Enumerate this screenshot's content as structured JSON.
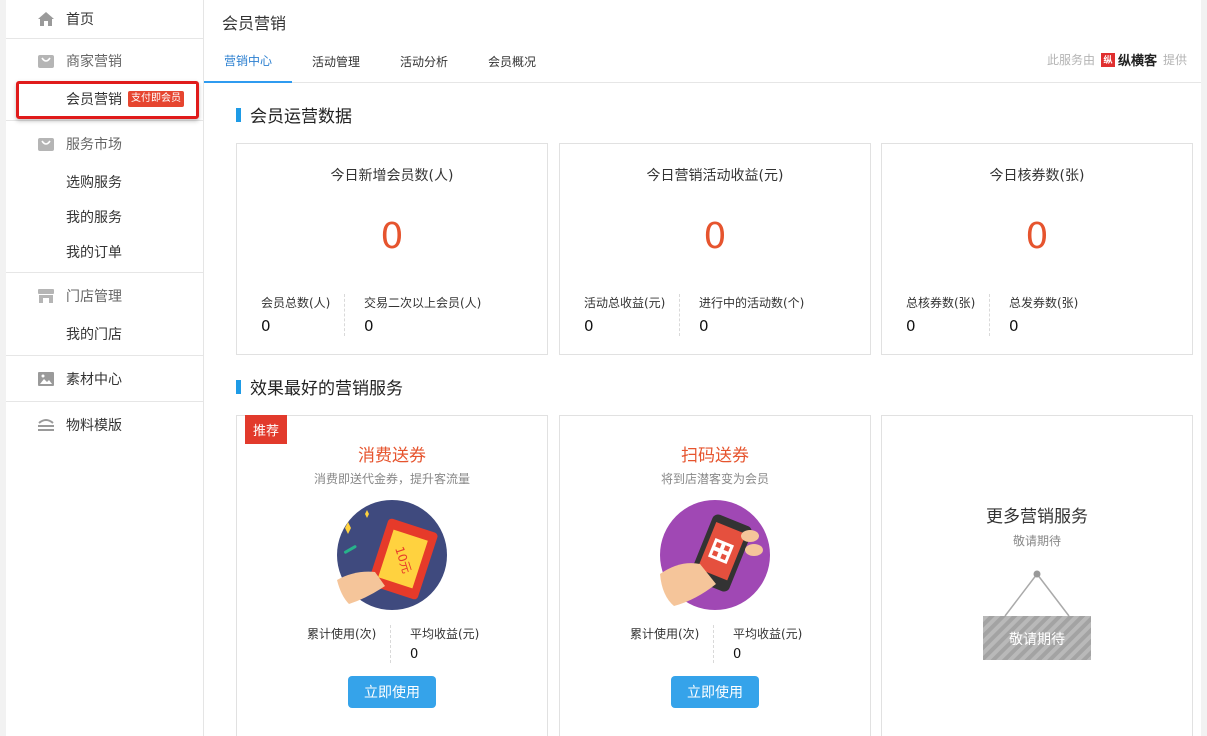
{
  "sidebar": {
    "home": "首页",
    "groups": [
      {
        "title": "商家营销",
        "items": [
          {
            "label": "会员营销",
            "badge": "支付即会员"
          }
        ]
      },
      {
        "title": "服务市场",
        "items": [
          {
            "label": "选购服务"
          },
          {
            "label": "我的服务"
          },
          {
            "label": "我的订单"
          }
        ]
      },
      {
        "title": "门店管理",
        "items": [
          {
            "label": "我的门店"
          }
        ]
      }
    ],
    "material": "素材中心",
    "template": "物料模版"
  },
  "header": {
    "title": "会员营销",
    "tabs": [
      {
        "label": "营销中心"
      },
      {
        "label": "活动管理"
      },
      {
        "label": "活动分析"
      },
      {
        "label": "会员概况"
      }
    ],
    "provider_prefix": "此服务由",
    "provider_name": "纵横客",
    "provider_suffix": "提供"
  },
  "ops": {
    "title": "会员运营数据",
    "cards": [
      {
        "title": "今日新增会员数(人)",
        "value": "0",
        "sub": [
          {
            "label": "会员总数(人)",
            "value": "0"
          },
          {
            "label": "交易二次以上会员(人)",
            "value": "0"
          }
        ]
      },
      {
        "title": "今日营销活动收益(元)",
        "value": "0",
        "sub": [
          {
            "label": "活动总收益(元)",
            "value": "0"
          },
          {
            "label": "进行中的活动数(个)",
            "value": "0"
          }
        ]
      },
      {
        "title": "今日核券数(张)",
        "value": "0",
        "sub": [
          {
            "label": "总核券数(张)",
            "value": "0"
          },
          {
            "label": "总发券数(张)",
            "value": "0"
          }
        ]
      }
    ]
  },
  "services": {
    "title": "效果最好的营销服务",
    "recommend": "推荐",
    "cards": [
      {
        "title": "消费送券",
        "desc": "消费即送代金券，提升客流量",
        "coupon_text": "10元",
        "used_label": "累计使用(次)",
        "used_value": "",
        "income_label": "平均收益(元)",
        "income_value": "0",
        "button": "立即使用"
      },
      {
        "title": "扫码送券",
        "desc": "将到店潜客变为会员",
        "used_label": "累计使用(次)",
        "used_value": "",
        "income_label": "平均收益(元)",
        "income_value": "0",
        "button": "立即使用"
      }
    ],
    "more": {
      "title": "更多营销服务",
      "desc": "敬请期待",
      "sign": "敬请期待"
    }
  },
  "colors": {
    "accent": "#35a3ea",
    "number": "#e6542e",
    "badge": "#e6452f",
    "highlight": "#e01b1b"
  }
}
